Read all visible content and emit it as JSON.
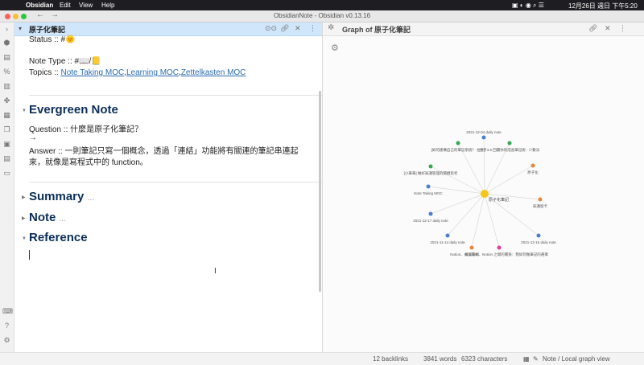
{
  "menubar": {
    "app": "Obsidian",
    "items": [
      "Edit",
      "View",
      "Help"
    ],
    "clock": "12月26日 週日 下午5:20"
  },
  "window": {
    "title": "ObsidianNote - Obsidian v0.13.16"
  },
  "left_pane": {
    "title": "原子化筆記",
    "status_line": "Status :: #🌞",
    "note_type_line": "Note Type :: #📖/📒",
    "topics_label": "Topics ::",
    "topics": [
      "Note Taking MOC",
      "Learning MOC",
      "Zettelkasten MOC"
    ],
    "sections": {
      "evergreen": "Evergreen Note",
      "summary": "Summary",
      "note": "Note",
      "reference": "Reference",
      "collapsed_marker": "..."
    },
    "question": "Question :: 什麼是原子化筆記？",
    "arrow": "→",
    "answer_line1": "Answer :: 一則筆記只寫一個概念，透過「連結」功能將有關連的筆記串連起",
    "answer_line2": "來，就像是寫程式中的 function。"
  },
  "right_pane": {
    "title": "Graph of 原子化筆記"
  },
  "graph": {
    "center": {
      "label": "原子化筆記",
      "color": "#f5c518"
    },
    "nodes": [
      {
        "label": "2021-12-04 daily note",
        "color": "#4a7fcf"
      },
      {
        "label": "[如何建構自己的筆記系統？ 拉卡]",
        "color": "#34a853"
      },
      {
        "label": "拉卡3.5 回饋你的成長筆記術 - 少數派",
        "color": "#34a853"
      },
      {
        "label": "[小筆筆] 做好知識管理的關鍵思考",
        "color": "#34a853"
      },
      {
        "label": "原子化",
        "color": "#e8863a"
      },
      {
        "label": "Note Taking MOC",
        "color": "#4a7fcf"
      },
      {
        "label": "知識留卡",
        "color": "#e8863a"
      },
      {
        "label": "2021-12-17 daily note",
        "color": "#4a7fcf"
      },
      {
        "label": "2021-12-16 daily note",
        "color": "#4a7fcf"
      },
      {
        "label": "2021-11-14 daily note",
        "color": "#4a7fcf"
      },
      {
        "label": "長度警惕",
        "color": "#e8863a"
      },
      {
        "label": "Notion、Obsidian、Notion 之間的關係：我如何做筆記的選擇",
        "color": "#e23aa8"
      }
    ]
  },
  "statusbar": {
    "backlinks": "12 backlinks",
    "words": "3841 words",
    "characters": "6323 characters",
    "view": "Note / Local graph view"
  }
}
